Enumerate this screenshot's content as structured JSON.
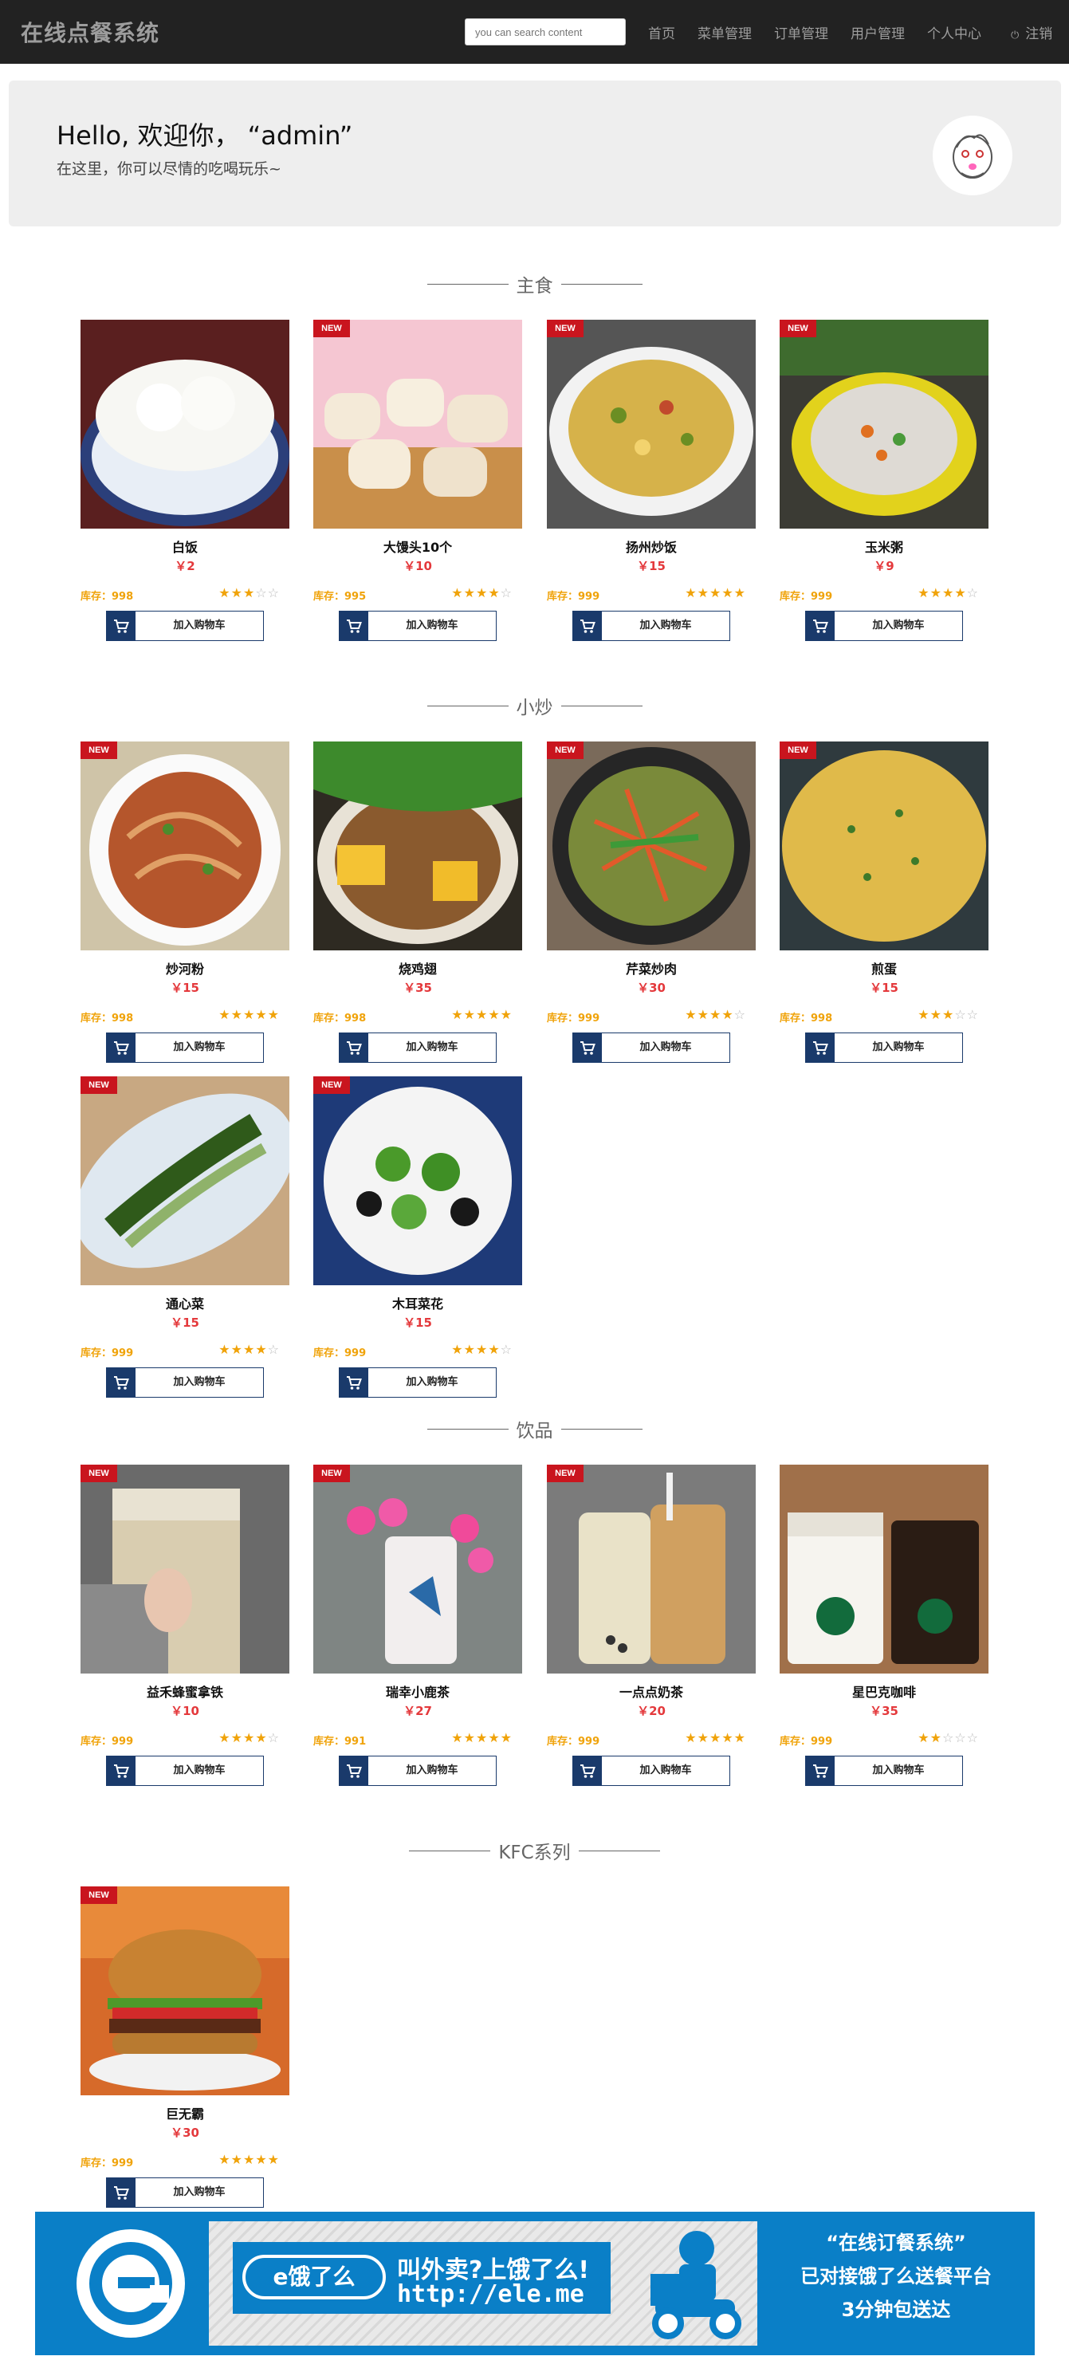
{
  "nav": {
    "brand": "在线点餐系统",
    "search_placeholder": "you can search content",
    "links": [
      "首页",
      "菜单管理",
      "订单管理",
      "用户管理",
      "个人中心"
    ],
    "logout": "注销"
  },
  "jumbotron": {
    "greeting": "Hello, 欢迎你， “admin”",
    "subtitle": "在这里，你可以尽情的吃喝玩乐~"
  },
  "common": {
    "new_badge": "NEW",
    "cart_label": "加入购物车",
    "stock_prefix": "库存："
  },
  "sections": [
    {
      "title": "主食",
      "items": [
        {
          "name": "白饭",
          "price": "￥2",
          "stock": "998",
          "stars": 3,
          "new": false,
          "icon": "rice-bowl-image"
        },
        {
          "name": "大馒头10个",
          "price": "￥10",
          "stock": "995",
          "stars": 4,
          "new": true,
          "icon": "steamed-buns-image"
        },
        {
          "name": "扬州炒饭",
          "price": "￥15",
          "stock": "999",
          "stars": 5,
          "new": true,
          "icon": "fried-rice-image"
        },
        {
          "name": "玉米粥",
          "price": "￥9",
          "stock": "999",
          "stars": 4,
          "new": true,
          "icon": "corn-porridge-image"
        }
      ]
    },
    {
      "title": "小炒",
      "items": [
        {
          "name": "炒河粉",
          "price": "￥15",
          "stock": "998",
          "stars": 5,
          "new": true,
          "icon": "fried-noodles-image"
        },
        {
          "name": "烧鸡翅",
          "price": "￥35",
          "stock": "998",
          "stars": 5,
          "new": false,
          "icon": "chicken-wings-image"
        },
        {
          "name": "芹菜炒肉",
          "price": "￥30",
          "stock": "999",
          "stars": 4,
          "new": true,
          "icon": "celery-pork-image"
        },
        {
          "name": "煎蛋",
          "price": "￥15",
          "stock": "998",
          "stars": 3,
          "new": true,
          "icon": "omelette-image"
        },
        {
          "name": "通心菜",
          "price": "￥15",
          "stock": "999",
          "stars": 4,
          "new": true,
          "icon": "water-spinach-image"
        },
        {
          "name": "木耳菜花",
          "price": "￥15",
          "stock": "999",
          "stars": 4,
          "new": true,
          "icon": "fungus-broccoli-image"
        }
      ]
    },
    {
      "title": "饮品",
      "items": [
        {
          "name": "益禾蜂蜜拿铁",
          "price": "￥10",
          "stock": "999",
          "stars": 4,
          "new": true,
          "icon": "honey-latte-image"
        },
        {
          "name": "瑞幸小鹿茶",
          "price": "￥27",
          "stock": "991",
          "stars": 5,
          "new": true,
          "icon": "deer-tea-image"
        },
        {
          "name": "一点点奶茶",
          "price": "￥20",
          "stock": "999",
          "stars": 5,
          "new": true,
          "icon": "milk-tea-image"
        },
        {
          "name": "星巴克咖啡",
          "price": "￥35",
          "stock": "999",
          "stars": 2,
          "new": false,
          "icon": "starbucks-coffee-image"
        }
      ]
    },
    {
      "title": "KFC系列",
      "items": [
        {
          "name": "巨无霸",
          "price": "￥30",
          "stock": "999",
          "stars": 5,
          "new": true,
          "icon": "burger-image"
        }
      ]
    }
  ],
  "footer": {
    "brand": "e饿了么",
    "slogan": "叫外卖?上饿了么!",
    "url": "http://ele.me",
    "right_lines": [
      "“在线订餐系统”",
      "已对接饿了么送餐平台",
      "3分钟包送达"
    ]
  }
}
